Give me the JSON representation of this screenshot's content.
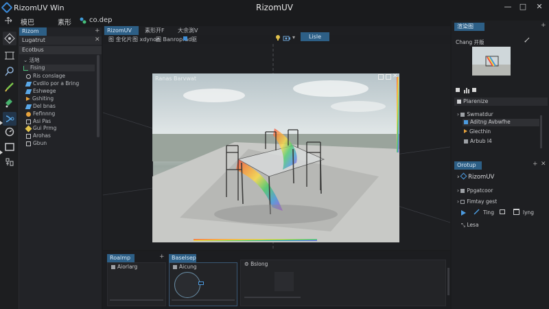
{
  "app": {
    "name": "RizomUV Win",
    "window_title": "RizomUV"
  },
  "window_controls": [
    "—",
    "□",
    "✕"
  ],
  "menu": [
    "模巴",
    "素形",
    "co.dep"
  ],
  "outliner": {
    "tabs": [
      "Rizom框",
      "Lugatrut"
    ],
    "section": "Ecotbus",
    "root": "活地",
    "items": [
      "Fising",
      "Ris conslage",
      "Cvdilo por a Bring",
      "Eshwege",
      "Gshiting",
      "Del bnas",
      "Feflnnng",
      "Asi Pas",
      "Gui Prmg",
      "Arohas",
      "Gbun"
    ]
  },
  "center": {
    "tabs": [
      "RizomUV bue",
      "素形开F",
      "大余測V"
    ],
    "toolbar": [
      "图 金化片",
      "图 xdynon",
      "图 Banroprad",
      "图",
      "驱"
    ],
    "mode_label": "Lisle",
    "render_title": "Ranas Barvwat"
  },
  "bottom": {
    "tabs": [
      "Roalmp",
      "Baselsep"
    ],
    "panels": [
      "Aiorlarg",
      "Aicung",
      "Bslong"
    ]
  },
  "right": {
    "preview_tab": "渲染图",
    "preview_label": "Chang 开版",
    "scene_tab": "Plarenize",
    "scene_items": [
      "Swmatdur",
      "Aditng Avbwfhe",
      "Glecthin",
      "Arbub l4"
    ],
    "uv_tab": "Orotup",
    "uv_title": "RizomUV",
    "uv_items": [
      "Ppgatcoor",
      "Fimtay gest"
    ],
    "uv_tools": [
      "Ting",
      "lyng",
      "Lesa"
    ]
  },
  "colors": {
    "accent": "#2d5f86",
    "panel": "#232427",
    "background": "#1b1c1e"
  }
}
